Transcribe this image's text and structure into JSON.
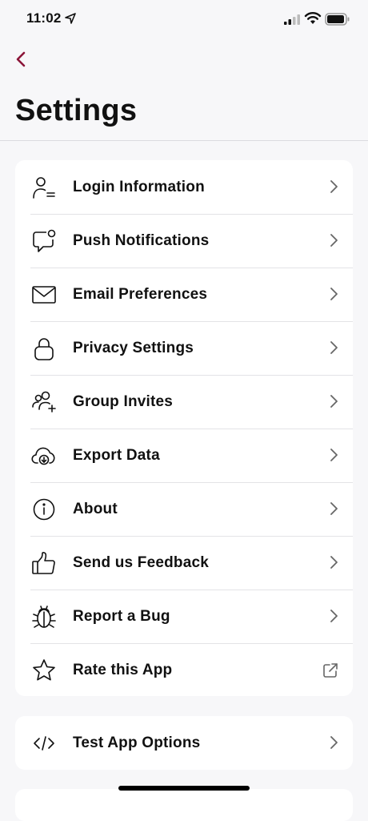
{
  "status_bar": {
    "time": "11:02",
    "icons": [
      "location-arrow-icon",
      "cellular-signal-icon",
      "wifi-icon",
      "battery-icon"
    ]
  },
  "nav": {
    "back_icon": "chevron-left-icon",
    "title": "Settings"
  },
  "accent_color": "#8B1538",
  "settings": {
    "items": [
      {
        "label": "Login Information",
        "icon": "user-lines-icon",
        "trailing": "chevron-right-icon"
      },
      {
        "label": "Push Notifications",
        "icon": "message-badge-icon",
        "trailing": "chevron-right-icon"
      },
      {
        "label": "Email Preferences",
        "icon": "envelope-icon",
        "trailing": "chevron-right-icon"
      },
      {
        "label": "Privacy Settings",
        "icon": "lock-icon",
        "trailing": "chevron-right-icon"
      },
      {
        "label": "Group Invites",
        "icon": "users-plus-icon",
        "trailing": "chevron-right-icon"
      },
      {
        "label": "Export Data",
        "icon": "cloud-download-icon",
        "trailing": "chevron-right-icon"
      },
      {
        "label": "About",
        "icon": "info-circle-icon",
        "trailing": "chevron-right-icon"
      },
      {
        "label": "Send us Feedback",
        "icon": "thumbs-up-icon",
        "trailing": "chevron-right-icon"
      },
      {
        "label": "Report a Bug",
        "icon": "bug-icon",
        "trailing": "chevron-right-icon"
      },
      {
        "label": "Rate this App",
        "icon": "star-icon",
        "trailing": "external-link-icon"
      }
    ],
    "test_item": {
      "label": "Test App Options",
      "icon": "code-icon",
      "trailing": "chevron-right-icon"
    }
  }
}
